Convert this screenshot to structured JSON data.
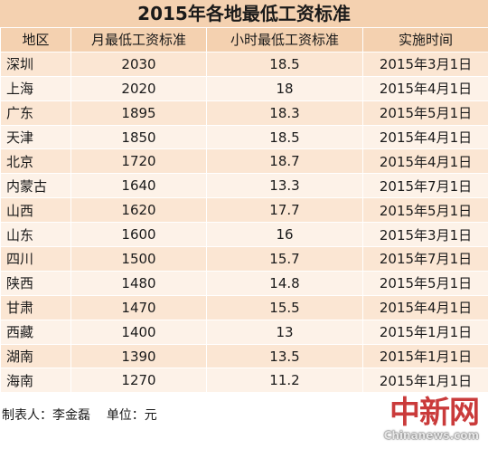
{
  "title": "2015年各地最低工资标准",
  "headers": [
    "地区",
    "月最低工资标准",
    "小时最低工资标准",
    "实施时间"
  ],
  "rows": [
    [
      "深圳",
      "2030",
      "18.5",
      "2015年3月1日"
    ],
    [
      "上海",
      "2020",
      "18",
      "2015年4月1日"
    ],
    [
      "广东",
      "1895",
      "18.3",
      "2015年5月1日"
    ],
    [
      "天津",
      "1850",
      "18.5",
      "2015年4月1日"
    ],
    [
      "北京",
      "1720",
      "18.7",
      "2015年4月1日"
    ],
    [
      "内蒙古",
      "1640",
      "13.3",
      "2015年7月1日"
    ],
    [
      "山西",
      "1620",
      "17.7",
      "2015年5月1日"
    ],
    [
      "山东",
      "1600",
      "16",
      "2015年3月1日"
    ],
    [
      "四川",
      "1500",
      "15.7",
      "2015年7月1日"
    ],
    [
      "陕西",
      "1480",
      "14.8",
      "2015年5月1日"
    ],
    [
      "甘肃",
      "1470",
      "15.5",
      "2015年4月1日"
    ],
    [
      "西藏",
      "1400",
      "13",
      "2015年1月1日"
    ],
    [
      "湖南",
      "1390",
      "13.5",
      "2015年1月1日"
    ],
    [
      "海南",
      "1270",
      "11.2",
      "2015年1月1日"
    ]
  ],
  "footer": {
    "maker": "制表人：李金磊",
    "unit": "单位：元"
  },
  "watermark": {
    "logo_text": "中新网",
    "site": "Chinanews.com"
  },
  "colors": {
    "header_bg": "#f4d1b0",
    "row_odd_bg": "#fbe6d3",
    "row_even_bg": "#fdf2e8",
    "watermark_red": "#c32020"
  }
}
